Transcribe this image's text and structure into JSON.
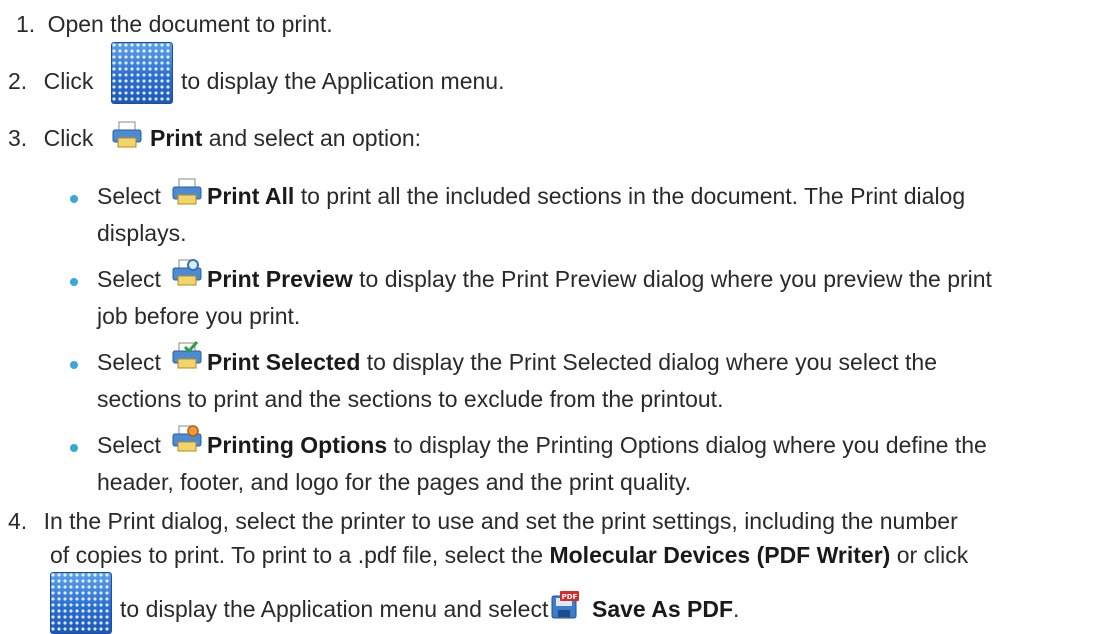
{
  "steps": {
    "s1": {
      "num": "1.",
      "text": "Open the document to print."
    },
    "s2": {
      "num": "2.",
      "pre": "Click",
      "post": "to display the Application menu."
    },
    "s3": {
      "num": "3.",
      "pre": "Click",
      "bold": "Print",
      "post": "and select an option:"
    },
    "options": [
      {
        "pre": "Select",
        "bold": "Print All",
        "line1": "to print all the included sections in the document. The Print dialog",
        "line2": "displays."
      },
      {
        "pre": "Select",
        "bold": "Print Preview",
        "line1": "to display the Print Preview dialog where you preview the print",
        "line2": "job before you print."
      },
      {
        "pre": "Select",
        "bold": "Print Selected",
        "line1": "to display the Print Selected dialog where you select the",
        "line2": "sections to print and the sections to exclude from the printout."
      },
      {
        "pre": "Select",
        "bold": "Printing Options",
        "line1": "to display the Printing Options dialog where you define the",
        "line2": "header, footer, and logo for the pages and the print quality."
      }
    ],
    "s4": {
      "num": "4.",
      "line1": "In the Print dialog, select the printer to use and set the print settings, including the number",
      "line2_pre": "of copies to print. To print to a .pdf file, select the",
      "line2_bold": "Molecular Devices (PDF Writer)",
      "line2_post": "or click",
      "line3_pre": "to display the Application menu and select",
      "line3_bold": "Save As PDF",
      "line3_post": "."
    }
  },
  "icons": {
    "application_menu": "application-menu-icon",
    "print": "printer-icon",
    "pdf_label": "PDF"
  }
}
